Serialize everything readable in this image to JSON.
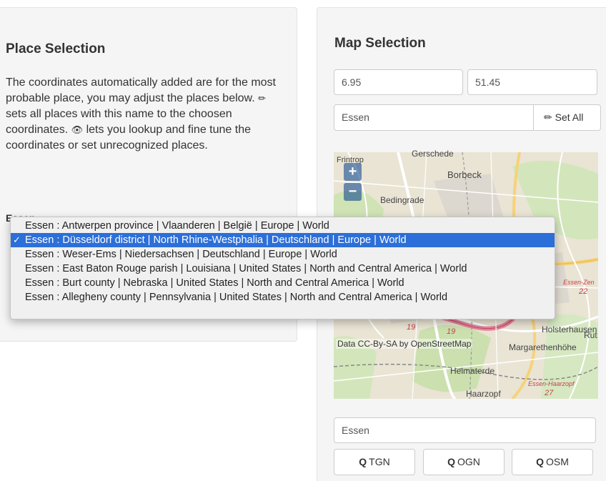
{
  "place_selection": {
    "title": "Place Selection",
    "desc_part1": "The coordinates automatically added are for the most probable place, you may adjust the places below.",
    "desc_part2": "sets all places with this name to the choosen coordinates.",
    "desc_part3": "lets you lookup and fine tune the coordinates or set unrecognized places.",
    "group_label": "Essen:"
  },
  "dropdown": {
    "selected_index": 1,
    "options": [
      "Essen : Antwerpen province | Vlaanderen | België | Europe | World",
      "Essen : Düsseldorf district | North Rhine-Westphalia | Deutschland | Europe | World",
      "Essen : Weser-Ems | Niedersachsen | Deutschland | Europe | World",
      "Essen : East Baton Rouge parish | Louisiana | United States | North and Central America | World",
      "Essen : Burt county | Nebraska | United States | North and Central America | World",
      "Essen : Allegheny county | Pennsylvania | United States | North and Central America | World"
    ]
  },
  "map_selection": {
    "title": "Map Selection",
    "longitude": "6.95",
    "latitude": "51.45",
    "place_name": "Essen",
    "set_all_label": "Set All",
    "search_value": "Essen",
    "buttons": [
      "TGN",
      "OGN",
      "OSM"
    ]
  },
  "map": {
    "zoom_in": "+",
    "zoom_out": "−",
    "attribution": "Data CC-By-SA by OpenStreetMap",
    "labels": {
      "gerschede": "Gerschede",
      "borbeck": "Borbeck",
      "bedingrade": "Bedingrade",
      "frintrop": "Frintrop",
      "holsterhausen": "Holsterhausen",
      "rut": "Rut",
      "margarethenhohe": "Margarethenhöhe",
      "heimaterde": "Heimaterde",
      "haarzopf": "Haarzopf",
      "essen_zen": "Essen-Zen",
      "essen_hz": "Essen-Haarzopf",
      "n19a": "19",
      "n19b": "19",
      "n22": "22",
      "n27": "27"
    }
  },
  "colors": {
    "panel_bg": "#f5f5f5",
    "selected_option": "#2c6fd8",
    "map_bg": "#e9e4d4",
    "zoom_btn": "#003c88"
  }
}
